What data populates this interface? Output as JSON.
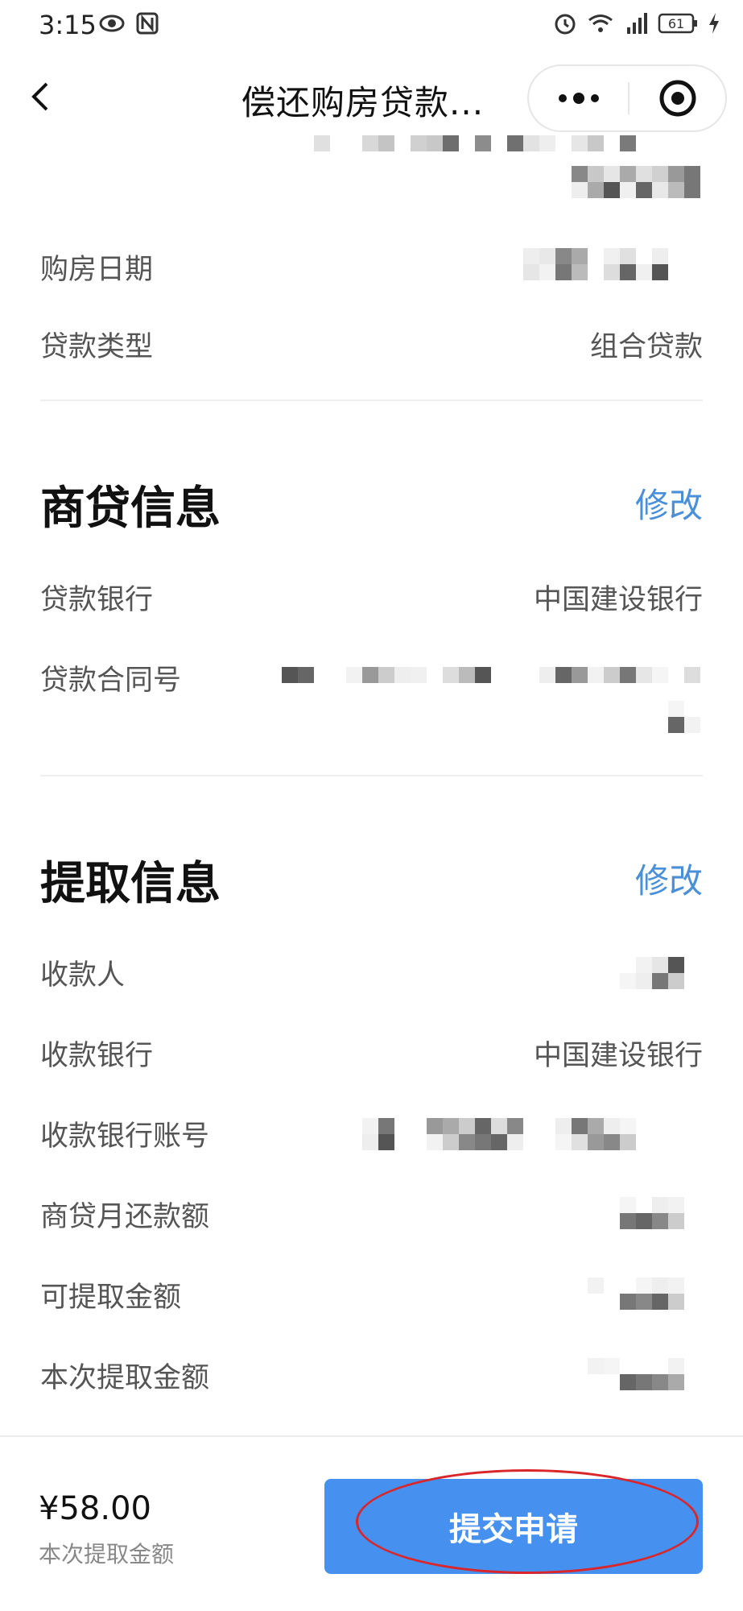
{
  "status_bar": {
    "time": "3:15",
    "battery": "61"
  },
  "nav": {
    "title": "偿还购房贷款..."
  },
  "house_info": {
    "purchase_date_label": "购房日期",
    "loan_type_label": "贷款类型",
    "loan_type_value": "组合贷款"
  },
  "commercial_loan": {
    "title": "商贷信息",
    "edit_label": "修改",
    "bank_label": "贷款银行",
    "bank_value": "中国建设银行",
    "contract_label": "贷款合同号"
  },
  "withdraw_info": {
    "title": "提取信息",
    "edit_label": "修改",
    "payee_label": "收款人",
    "payee_bank_label": "收款银行",
    "payee_bank_value": "中国建设银行",
    "account_label": "收款银行账号",
    "monthly_label": "商贷月还款额",
    "available_label": "可提取金额",
    "current_label": "本次提取金额"
  },
  "footer": {
    "amount": "¥58.00",
    "caption": "本次提取金额",
    "submit_label": "提交申请"
  },
  "colors": {
    "accent": "#4a90d9",
    "button": "#4690ef",
    "annotation": "#d9262b"
  }
}
